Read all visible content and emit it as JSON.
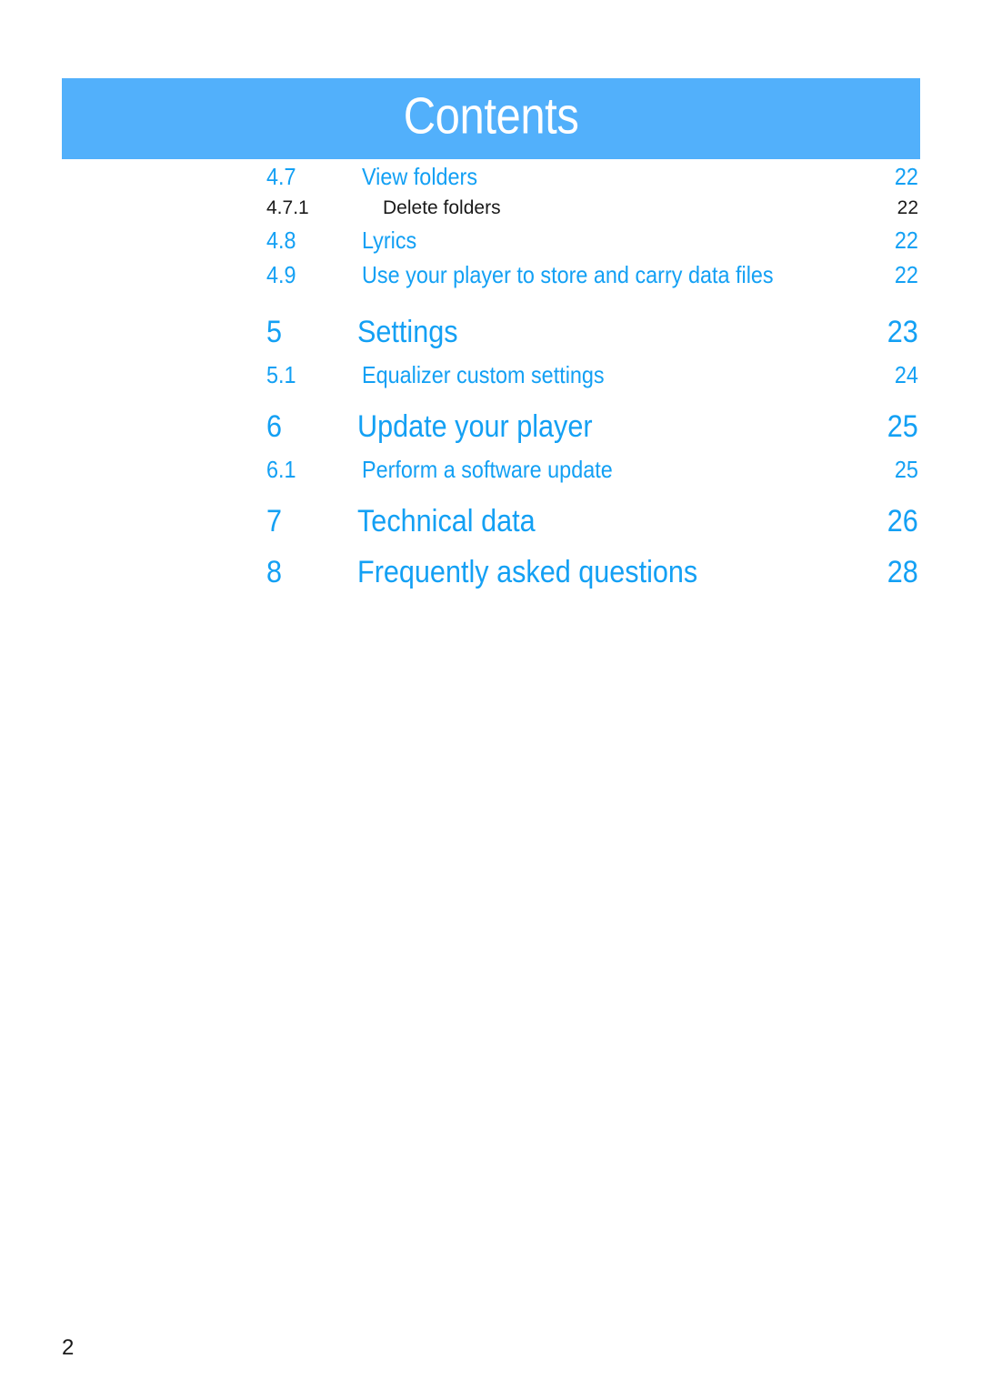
{
  "page": {
    "title": "Contents",
    "footer_page_number": "2",
    "accent_blue": "#13a0f4",
    "banner_blue": "#52b0fb",
    "body_black": "#1a1a1a"
  },
  "toc": {
    "entries": [
      {
        "number": "4.7",
        "title": "View folders",
        "page": "22",
        "level": "sub"
      },
      {
        "number": "4.7.1",
        "title": "Delete folders",
        "page": "22",
        "level": "subsub"
      },
      {
        "number": "4.8",
        "title": "Lyrics",
        "page": "22",
        "level": "sub"
      },
      {
        "number": "4.9",
        "title": "Use your player to store and carry data files",
        "page": "22",
        "level": "sub"
      },
      {
        "number": "5",
        "title": "Settings",
        "page": "23",
        "level": "chapter"
      },
      {
        "number": "5.1",
        "title": "Equalizer custom settings",
        "page": "24",
        "level": "sub"
      },
      {
        "number": "6",
        "title": "Update your player",
        "page": "25",
        "level": "chapter"
      },
      {
        "number": "6.1",
        "title": "Perform a software update",
        "page": "25",
        "level": "sub"
      },
      {
        "number": "7",
        "title": "Technical data",
        "page": "26",
        "level": "chapter"
      },
      {
        "number": "8",
        "title": "Frequently asked questions",
        "page": "28",
        "level": "chapter"
      }
    ]
  }
}
